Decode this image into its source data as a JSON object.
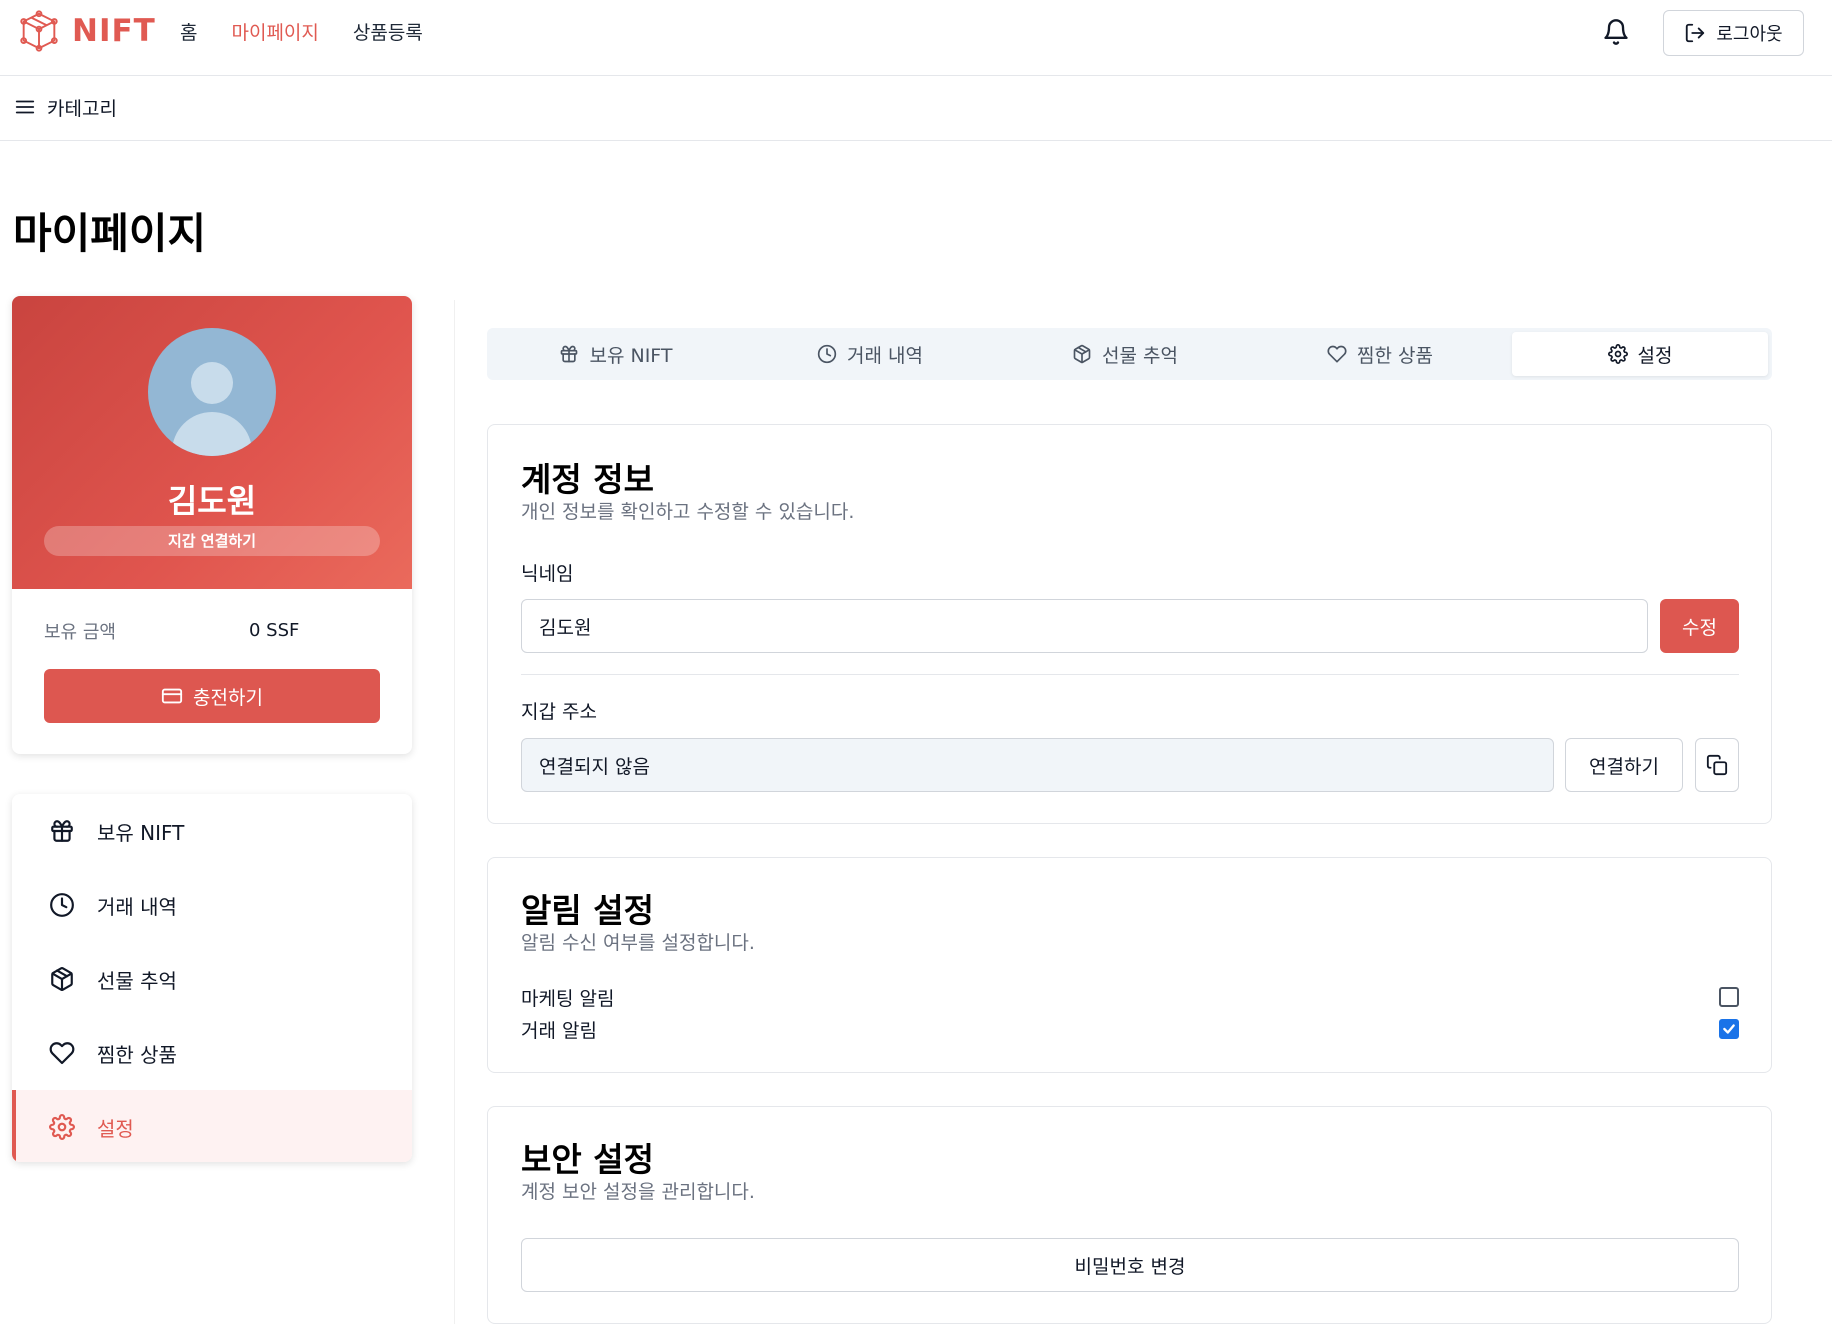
{
  "header": {
    "brand": "NIFT",
    "nav": [
      {
        "label": "홈",
        "active": false
      },
      {
        "label": "마이페이지",
        "active": true
      },
      {
        "label": "상품등록",
        "active": false
      }
    ],
    "logout_label": "로그아웃"
  },
  "category_label": "카테고리",
  "page_title": "마이페이지",
  "profile": {
    "name": "김도원",
    "wallet_connect_label": "지갑 연결하기",
    "balance_label": "보유 금액",
    "balance_value": "0 SSF",
    "charge_label": "충전하기"
  },
  "side_menu": [
    {
      "label": "보유 NIFT",
      "icon": "gift-icon",
      "active": false
    },
    {
      "label": "거래 내역",
      "icon": "clock-icon",
      "active": false
    },
    {
      "label": "선물 추억",
      "icon": "box-icon",
      "active": false
    },
    {
      "label": "찜한 상품",
      "icon": "heart-icon",
      "active": false
    },
    {
      "label": "설정",
      "icon": "gear-icon",
      "active": true
    }
  ],
  "tabs": [
    {
      "label": "보유 NIFT",
      "icon": "gift-icon",
      "active": false
    },
    {
      "label": "거래 내역",
      "icon": "clock-icon",
      "active": false
    },
    {
      "label": "선물 추억",
      "icon": "box-icon",
      "active": false
    },
    {
      "label": "찜한 상품",
      "icon": "heart-icon",
      "active": false
    },
    {
      "label": "설정",
      "icon": "gear-icon",
      "active": true
    }
  ],
  "account": {
    "title": "계정 정보",
    "description": "개인 정보를 확인하고 수정할 수 있습니다.",
    "nickname_label": "닉네임",
    "nickname_value": "김도원",
    "edit_label": "수정",
    "wallet_label": "지갑 주소",
    "wallet_value": "연결되지 않음",
    "connect_label": "연결하기"
  },
  "notifications": {
    "title": "알림 설정",
    "description": "알림 수신 여부를 설정합니다.",
    "items": [
      {
        "label": "마케팅 알림",
        "checked": false
      },
      {
        "label": "거래 알림",
        "checked": true
      }
    ]
  },
  "security": {
    "title": "보안 설정",
    "description": "계정 보안 설정을 관리합니다.",
    "change_password_label": "비밀번호 변경"
  },
  "colors": {
    "brand": "#e05a52",
    "checkbox_checked": "#1a73e8"
  }
}
